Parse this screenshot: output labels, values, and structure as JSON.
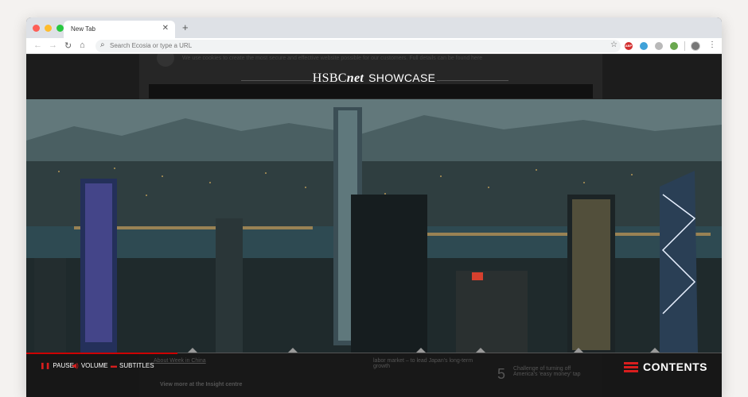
{
  "browser": {
    "tab_title": "New Tab",
    "omnibox_placeholder": "Search Ecosia or type a URL",
    "ext_abp": "ABP",
    "traffic_lights": [
      "#fe5f57",
      "#febc2e",
      "#28c840"
    ]
  },
  "page": {
    "cookie_text": "We use cookies to create the most secure and effective website possible for our customers. Full details can be found here",
    "brand_hsbc": "HSBC",
    "brand_net": "net",
    "brand_showcase": "SHOWCASE",
    "bg_text_1": "About Week in China",
    "bg_text_2": "labor market – to lead Japan's long-term growth",
    "bg_text_3": "Challenge of turning off America's 'easy money' tap",
    "bg_text_4": "View more at the Insight centre",
    "bg_num_5": "5"
  },
  "controls": {
    "pause_label": "PAUSE",
    "volume_label": "VOLUME",
    "subtitles_label": "SUBTITLES",
    "contents_label": "CONTENTS",
    "accent": "#d81e1e"
  }
}
